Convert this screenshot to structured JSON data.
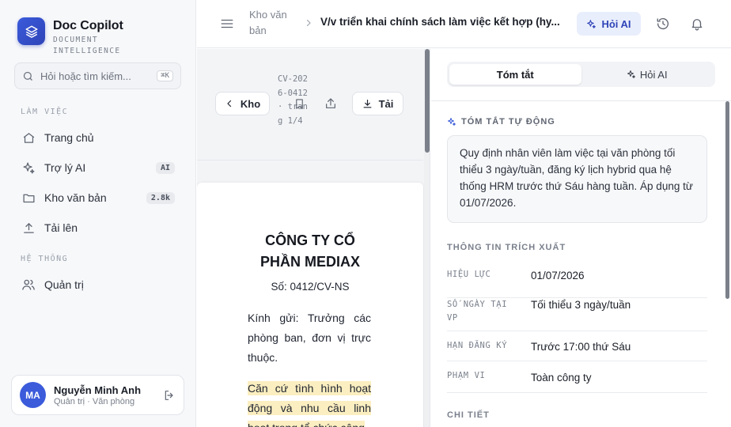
{
  "brand": {
    "name": "Doc Copilot",
    "subtitle": "DOCUMENT INTELLIGENCE"
  },
  "search": {
    "placeholder": "Hỏi hoặc tìm kiếm...",
    "shortcut": "⌘K"
  },
  "sidebar": {
    "section_work": "LÀM VIỆC",
    "section_system": "HỆ THỐNG",
    "items": [
      {
        "label": "Trang chủ",
        "icon": "home-icon"
      },
      {
        "label": "Trợ lý AI",
        "icon": "sparkle-icon",
        "badge": "AI"
      },
      {
        "label": "Kho văn bản",
        "icon": "folder-icon",
        "badge": "2.8k"
      },
      {
        "label": "Tải lên",
        "icon": "upload-icon"
      },
      {
        "label": "Quản trị",
        "icon": "users-icon"
      }
    ]
  },
  "user": {
    "initials": "MA",
    "name": "Nguyễn Minh Anh",
    "role": "Quản trị · Văn phòng"
  },
  "header": {
    "breadcrumb_parent": "Kho văn bản",
    "breadcrumb_current": "V/v triển khai chính sách làm việc kết hợp (hy...",
    "ask_ai_label": "Hỏi AI"
  },
  "doc_toolbar": {
    "back_label": "Kho",
    "doc_meta": "CV-2026-0412 · trang 1/4",
    "download_label": "Tải"
  },
  "document": {
    "company": "CÔNG TY CỔ PHẦN MEDIAX",
    "number": "Số: 0412/CV-NS",
    "recipient": "Kính gửi: Trưởng các phòng ban, đơn vị trực thuộc.",
    "body_highlight": "Căn cứ tình hình hoạt động và nhu cầu linh hoạt trong tổ chức công"
  },
  "panel": {
    "tab_summary": "Tóm tắt",
    "tab_ask": "Hỏi AI",
    "auto_summary_title": "TÓM TẮT TỰ ĐỘNG",
    "summary_text": "Quy định nhân viên làm việc tại văn phòng tối thiểu 3 ngày/tuần, đăng ký lịch hybrid qua hệ thống HRM trước thứ Sáu hàng tuần. Áp dụng từ 01/07/2026.",
    "extracted_title": "THÔNG TIN TRÍCH XUẤT",
    "fields": [
      {
        "key": "HIỆU LỰC",
        "value": "01/07/2026"
      },
      {
        "key": "SỐ NGÀY TẠI VP",
        "value": "Tối thiểu 3 ngày/tuần"
      },
      {
        "key": "HẠN ĐĂNG KÝ",
        "value": "Trước 17:00 thứ Sáu"
      },
      {
        "key": "PHẠM VI",
        "value": "Toàn công ty"
      }
    ],
    "details_title": "CHI TIẾT"
  },
  "colors": {
    "accent": "#3b5bdb",
    "accent_soft": "#e9eefc",
    "highlight": "#fbeec0"
  }
}
